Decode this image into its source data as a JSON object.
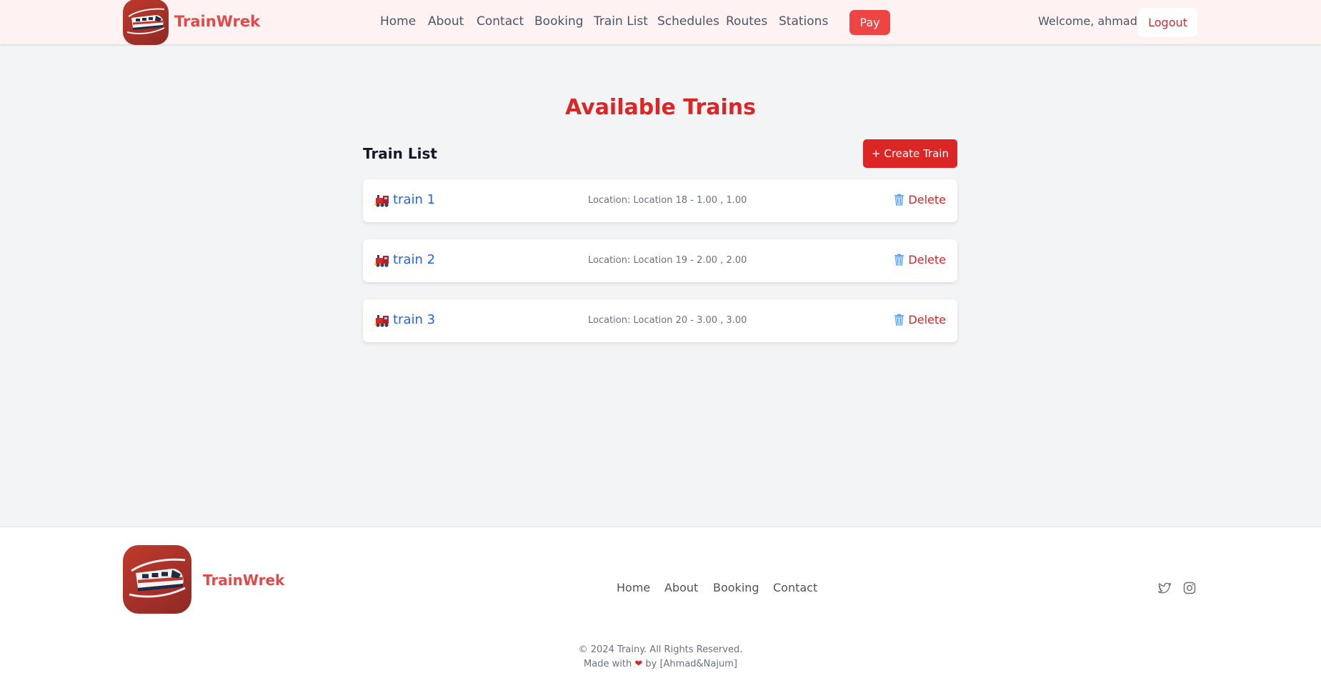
{
  "header": {
    "brand": "TrainWrek",
    "nav": [
      "Home",
      "About",
      "Contact",
      "Booking",
      "Train List",
      "Schedules",
      "Routes",
      "Stations"
    ],
    "pay_label": "Pay",
    "welcome": "Welcome, ahmad",
    "logout_label": "Logout"
  },
  "main": {
    "title": "Available Trains",
    "list_title": "Train List",
    "create_label": "+ Create Train",
    "trains": [
      {
        "name": "train 1",
        "location": "Location: Location 18 - 1.00 , 1.00",
        "delete_label": "Delete"
      },
      {
        "name": "train 2",
        "location": "Location: Location 19 - 2.00 , 2.00",
        "delete_label": "Delete"
      },
      {
        "name": "train 3",
        "location": "Location: Location 20 - 3.00 , 3.00",
        "delete_label": "Delete"
      }
    ]
  },
  "footer": {
    "brand": "TrainWrek",
    "nav": [
      "Home",
      "About",
      "Booking",
      "Contact"
    ],
    "social_icons": [
      "twitter-icon",
      "instagram-icon"
    ],
    "copyright": "© 2024 Trainy. All Rights Reserved.",
    "made_with_prefix": "Made with",
    "made_with_suffix": "by [Ahmad&Najum]"
  },
  "colors": {
    "accent": "#dc2626",
    "brand_text": "#e24a4a",
    "link": "#2563eb",
    "header_bg": "#fef2f2"
  }
}
